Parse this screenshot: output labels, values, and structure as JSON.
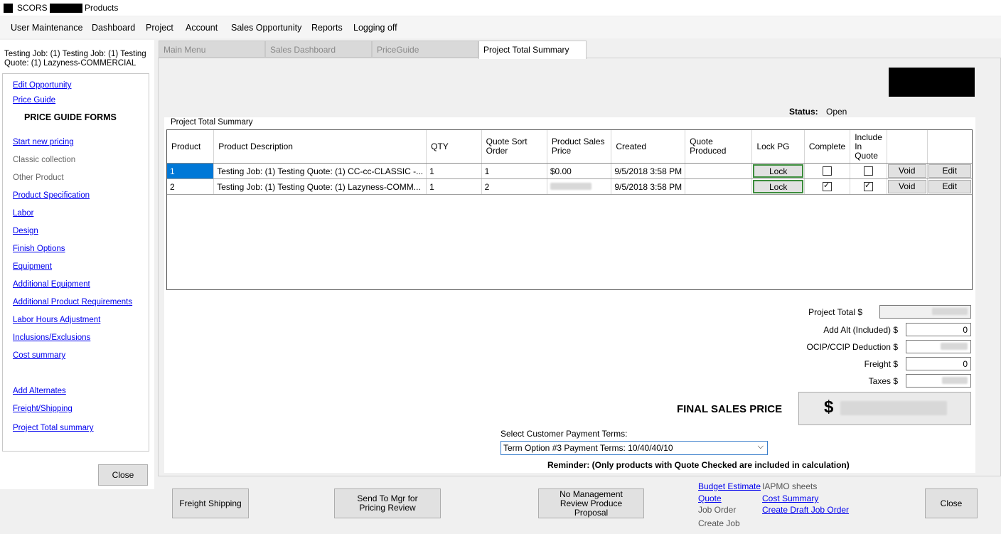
{
  "window": {
    "title_prefix": "SCORS -",
    "title_suffix": "Products"
  },
  "menu": [
    "User Maintenance",
    "Dashboard",
    "Project",
    "Account",
    "Sales Opportunity",
    "Reports",
    "Logging off"
  ],
  "left": {
    "header": "Testing Job: (1) Testing Job: (1) Testing Quote: (1) Lazyness-COMMERCIAL",
    "edit_opportunity": "Edit Opportunity",
    "price_guide": "Price Guide",
    "section_title": "PRICE GUIDE FORMS",
    "items": [
      {
        "label": "Start new pricing",
        "link": true
      },
      {
        "label": "Classic collection",
        "link": false
      },
      {
        "label": "Other Product",
        "link": false
      },
      {
        "label": "Product Specification",
        "link": true
      },
      {
        "label": "Labor",
        "link": true
      },
      {
        "label": "Design",
        "link": true
      },
      {
        "label": "Finish Options",
        "link": true
      },
      {
        "label": "Equipment",
        "link": true
      },
      {
        "label": "Additional Equipment",
        "link": true
      },
      {
        "label": "Additional Product Requirements",
        "link": true
      },
      {
        "label": "Labor Hours Adjustment",
        "link": true
      },
      {
        "label": "Inclusions/Exclusions",
        "link": true
      },
      {
        "label": "Cost summary",
        "link": true
      }
    ],
    "add_alternates": "Add Alternates",
    "freight_shipping": "Freight/Shipping",
    "project_total_summary": "Project Total summary",
    "close_label": "Close"
  },
  "tabs": [
    {
      "label": "Main Menu",
      "active": false
    },
    {
      "label": "Sales Dashboard",
      "active": false
    },
    {
      "label": "PriceGuide",
      "active": false
    },
    {
      "label": "Project Total Summary",
      "active": true
    }
  ],
  "status": {
    "label": "Status:",
    "value": "Open"
  },
  "group_title": "Project Total Summary",
  "grid": {
    "columns": [
      "Product",
      "Product Description",
      "QTY",
      "Quote Sort Order",
      "Product Sales Price",
      "Created",
      "Quote Produced",
      "Lock PG",
      "Complete",
      "Include In Quote",
      "",
      ""
    ],
    "rows": [
      {
        "product": "1",
        "description": "Testing Job: (1) Testing Quote: (1) CC-cc-CLASSIC -...",
        "qty": "1",
        "sort": "1",
        "price": "$0.00",
        "created": "9/5/2018 3:58 PM",
        "quote_produced": "",
        "lock": "Lock",
        "complete": false,
        "include": false,
        "void": "Void",
        "edit": "Edit"
      },
      {
        "product": "2",
        "description": "Testing Job: (1) Testing Quote: (1) Lazyness-COMM...",
        "qty": "1",
        "sort": "2",
        "price": "",
        "created": "9/5/2018 3:58 PM",
        "quote_produced": "",
        "lock": "Lock",
        "complete": true,
        "include": true,
        "void": "Void",
        "edit": "Edit"
      }
    ]
  },
  "totals": {
    "project_total_label": "Project Total  $",
    "add_alt_label": "Add Alt (Included) $",
    "add_alt_value": "0",
    "ocip_label": "OCIP/CCIP Deduction $",
    "freight_label": "Freight  $",
    "freight_value": "0",
    "taxes_label": "Taxes  $",
    "final_label": "FINAL SALES PRICE",
    "final_currency": "$"
  },
  "payment": {
    "label": "Select Customer Payment Terms:",
    "selected": "Term Option #3 Payment Terms: 10/40/40/10"
  },
  "reminder": "Reminder: (Only products with Quote Checked are included in calculation)",
  "bottom": {
    "freight_button": "Freight Shipping",
    "send_mgr_button": "Send To Mgr for Pricing Review",
    "no_mgmt_button": "No Management Review Produce Proposal",
    "budget_estimate": "Budget Estimate",
    "iapmo_sheets": "IAPMO sheets",
    "quote": "Quote",
    "cost_summary": "Cost Summary",
    "job_order": "Job Order",
    "create_draft_job_order": "Create Draft Job Order",
    "create_job": "Create Job",
    "close_button": "Close"
  }
}
